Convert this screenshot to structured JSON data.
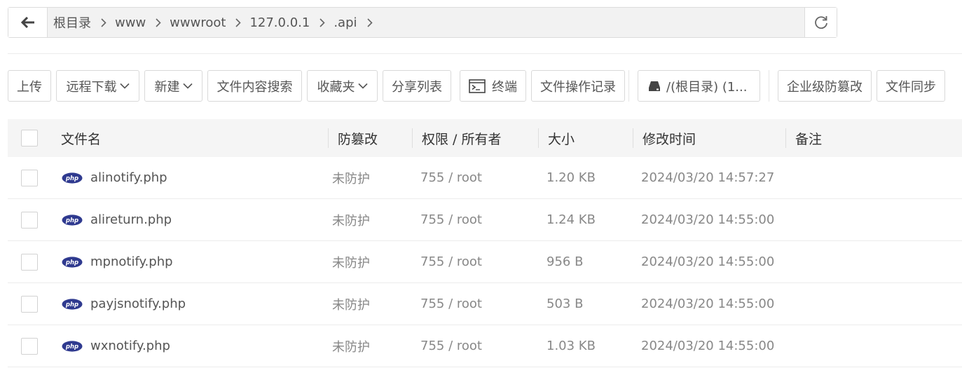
{
  "breadcrumb": {
    "items": [
      "根目录",
      "www",
      "wwwroot",
      "127.0.0.1",
      ".api"
    ]
  },
  "toolbar": {
    "upload": "上传",
    "remote_download": "远程下载",
    "new": "新建",
    "content_search": "文件内容搜索",
    "favorites": "收藏夹",
    "share_list": "分享列表",
    "terminal": "终端",
    "operation_log": "文件操作记录",
    "disk": "/(根目录) (1...",
    "enterprise_tamper": "企业级防篡改",
    "file_sync": "文件同步"
  },
  "table": {
    "headers": {
      "name": "文件名",
      "protect": "防篡改",
      "perm": "权限 / 所有者",
      "size": "大小",
      "mtime": "修改时间",
      "note": "备注"
    },
    "rows": [
      {
        "name": "alinotify.php",
        "protect": "未防护",
        "perm": "755 / root",
        "size": "1.20 KB",
        "mtime": "2024/03/20 14:57:27",
        "note": ""
      },
      {
        "name": "alireturn.php",
        "protect": "未防护",
        "perm": "755 / root",
        "size": "1.24 KB",
        "mtime": "2024/03/20 14:55:00",
        "note": ""
      },
      {
        "name": "mpnotify.php",
        "protect": "未防护",
        "perm": "755 / root",
        "size": "956 B",
        "mtime": "2024/03/20 14:55:00",
        "note": ""
      },
      {
        "name": "payjsnotify.php",
        "protect": "未防护",
        "perm": "755 / root",
        "size": "503 B",
        "mtime": "2024/03/20 14:55:00",
        "note": ""
      },
      {
        "name": "wxnotify.php",
        "protect": "未防护",
        "perm": "755 / root",
        "size": "1.03 KB",
        "mtime": "2024/03/20 14:55:00",
        "note": ""
      }
    ]
  },
  "icons": {
    "back": "arrow-left-icon",
    "refresh": "refresh-icon",
    "file": "php-file-icon",
    "terminal": "terminal-icon",
    "disk": "disk-icon"
  },
  "colors": {
    "php_badge": "#2f3a8f",
    "header_bg": "#f5f5f5",
    "border": "#d9d9d9"
  }
}
